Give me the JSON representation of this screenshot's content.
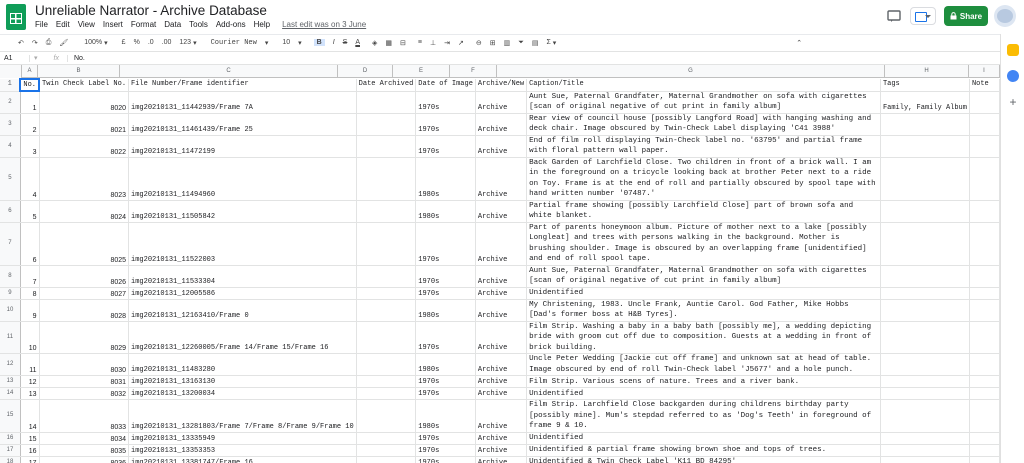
{
  "app": {
    "title": "Unreliable Narrator - Archive Database",
    "last_edit": "Last edit was on 3 June",
    "share_label": "Share",
    "menu": [
      "File",
      "Edit",
      "View",
      "Insert",
      "Format",
      "Data",
      "Tools",
      "Add-ons",
      "Help"
    ]
  },
  "toolbar": {
    "zoom": "100%",
    "currency": "£",
    "percent": "%",
    "dec_less": ".0",
    "dec_more": ".00",
    "more_formats": "123",
    "font": "Courier New",
    "font_size": "10",
    "bold": "B",
    "italic": "I",
    "strike": "S",
    "text_color": "A",
    "sigma": "Σ"
  },
  "formula_bar": {
    "cell_ref": "A1",
    "fx": "fx",
    "value": "No."
  },
  "columns": [
    "A",
    "B",
    "C",
    "D",
    "E",
    "F",
    "G",
    "H",
    "I"
  ],
  "headers": [
    "No.",
    "Twin Check Label No.",
    "File Number/Frame identifier",
    "Date Archived",
    "Date of Image",
    "Archive/New",
    "Caption/Title",
    "Tags",
    "Note"
  ],
  "rows": [
    {
      "no": "1",
      "label": "8020",
      "file": "img20210131_11442939/Frame 7A",
      "date": "1970s",
      "arch": "Archive",
      "caption": "Aunt Sue, Paternal Grandfater, Maternal Grandmother on sofa with cigarettes [scan of original negative of cut print in family album]",
      "tags": "Family, Family Album"
    },
    {
      "no": "2",
      "label": "8021",
      "file": "img20210131_11461439/Frame 25",
      "date": "1970s",
      "arch": "Archive",
      "caption": "Rear view of council house [possibly Langford Road] with hanging washing and deck chair. Image obscured by Twin-Check Label displaying 'C41 3988'",
      "tags": ""
    },
    {
      "no": "3",
      "label": "8022",
      "file": "img20210131_11472199",
      "date": "1970s",
      "arch": "Archive",
      "caption": "End of film roll displaying Twin-Check label no. '63795' and partial frame with floral pattern wall paper.",
      "tags": ""
    },
    {
      "no": "4",
      "label": "8023",
      "file": "img20210131_11494960",
      "date": "1980s",
      "arch": "Archive",
      "caption": "Back Garden of Larchfield Close. Two children in front of a brick wall. I am in the foreground on a tricycle looking back at brother Peter next to a ride on Toy. Frame is at the end of roll and partially obscured by spool tape with hand written number '07487.'",
      "tags": ""
    },
    {
      "no": "5",
      "label": "8024",
      "file": "img20210131_11505842",
      "date": "1980s",
      "arch": "Archive",
      "caption": "Partial frame showing [possibly Larchfield Close] part of brown sofa and white blanket.",
      "tags": ""
    },
    {
      "no": "6",
      "label": "8025",
      "file": "img20210131_11522003",
      "date": "1970s",
      "arch": "Archive",
      "caption": "Part of parents honeymoon album. Picture of mother next to a lake [possibly Longleat] and trees with persons walking in the background. Mother is brushing shoulder. Image is obscured by an overlapping frame [unidentified] and end of roll spool tape.",
      "tags": ""
    },
    {
      "no": "7",
      "label": "8026",
      "file": "img20210131_11533304",
      "date": "1970s",
      "arch": "Archive",
      "caption": "Aunt Sue, Paternal Grandfater, Maternal Grandmother on sofa with cigarettes [scan of original negative of cut print in family album]",
      "tags": ""
    },
    {
      "no": "8",
      "label": "8027",
      "file": "img20210131_12005586",
      "date": "1970s",
      "arch": "Archive",
      "caption": "Unidentified",
      "tags": ""
    },
    {
      "no": "9",
      "label": "8028",
      "file": "img20210131_12163410/Frame 0",
      "date": "1980s",
      "arch": "Archive",
      "caption": "My Christening, 1983. Uncle Frank, Auntie Carol. God Father, Mike Hobbs [Dad's former boss at H&B Tyres].",
      "tags": ""
    },
    {
      "no": "10",
      "label": "8029",
      "file": "img20210131_12260005/Frame 14/Frame 15/Frame 16",
      "date": "1970s",
      "arch": "Archive",
      "caption": "Film Strip. Washing a baby in a baby bath [possibly me], a wedding depicting bride with groom cut off due to composition. Guests at a wedding in front of brick building.",
      "tags": ""
    },
    {
      "no": "11",
      "label": "8030",
      "file": "img20210131_11483280",
      "date": "1980s",
      "arch": "Archive",
      "caption": "Uncle Peter Wedding [Jackie cut off frame] and unknown sat at head of table. Image obscured by end of roll Twin-Check label 'J5677' and a hole punch.",
      "tags": ""
    },
    {
      "no": "12",
      "label": "8031",
      "file": "img20210131_13163130",
      "date": "1970s",
      "arch": "Archive",
      "caption": "Film Strip. Various scens of nature. Trees and a river bank.",
      "tags": ""
    },
    {
      "no": "13",
      "label": "8032",
      "file": "img20210131_13200034",
      "date": "1970s",
      "arch": "Archive",
      "caption": "Unidentified",
      "tags": ""
    },
    {
      "no": "14",
      "label": "8033",
      "file": "img20210131_13281803/Frame 7/Frame 8/Frame 9/Frame 10",
      "date": "1980s",
      "arch": "Archive",
      "caption": "Film Strip. Larchfield Close backgarden during childrens birthday party [possibly mine]. Mum's stepdad referred to as 'Dog's Teeth' in foreground of frame 9 & 10.",
      "tags": ""
    },
    {
      "no": "15",
      "label": "8034",
      "file": "img20210131_13335949",
      "date": "1970s",
      "arch": "Archive",
      "caption": "Unidentified",
      "tags": ""
    },
    {
      "no": "16",
      "label": "8035",
      "file": "img20210131_13353353",
      "date": "1970s",
      "arch": "Archive",
      "caption": "Unidentified & partial frame showing brown shoe and tops of trees.",
      "tags": ""
    },
    {
      "no": "17",
      "label": "8036",
      "file": "img20210131_13381747/Frame 16",
      "date": "1970s",
      "arch": "Archive",
      "caption": "Unidentified & Twin Check Label 'K11 BD 84295'",
      "tags": ""
    }
  ],
  "row_numbers": [
    "1",
    "2",
    "3",
    "4",
    "5",
    "6",
    "7",
    "8",
    "9",
    "10",
    "11",
    "12",
    "13",
    "14",
    "15",
    "16",
    "17",
    "18"
  ]
}
